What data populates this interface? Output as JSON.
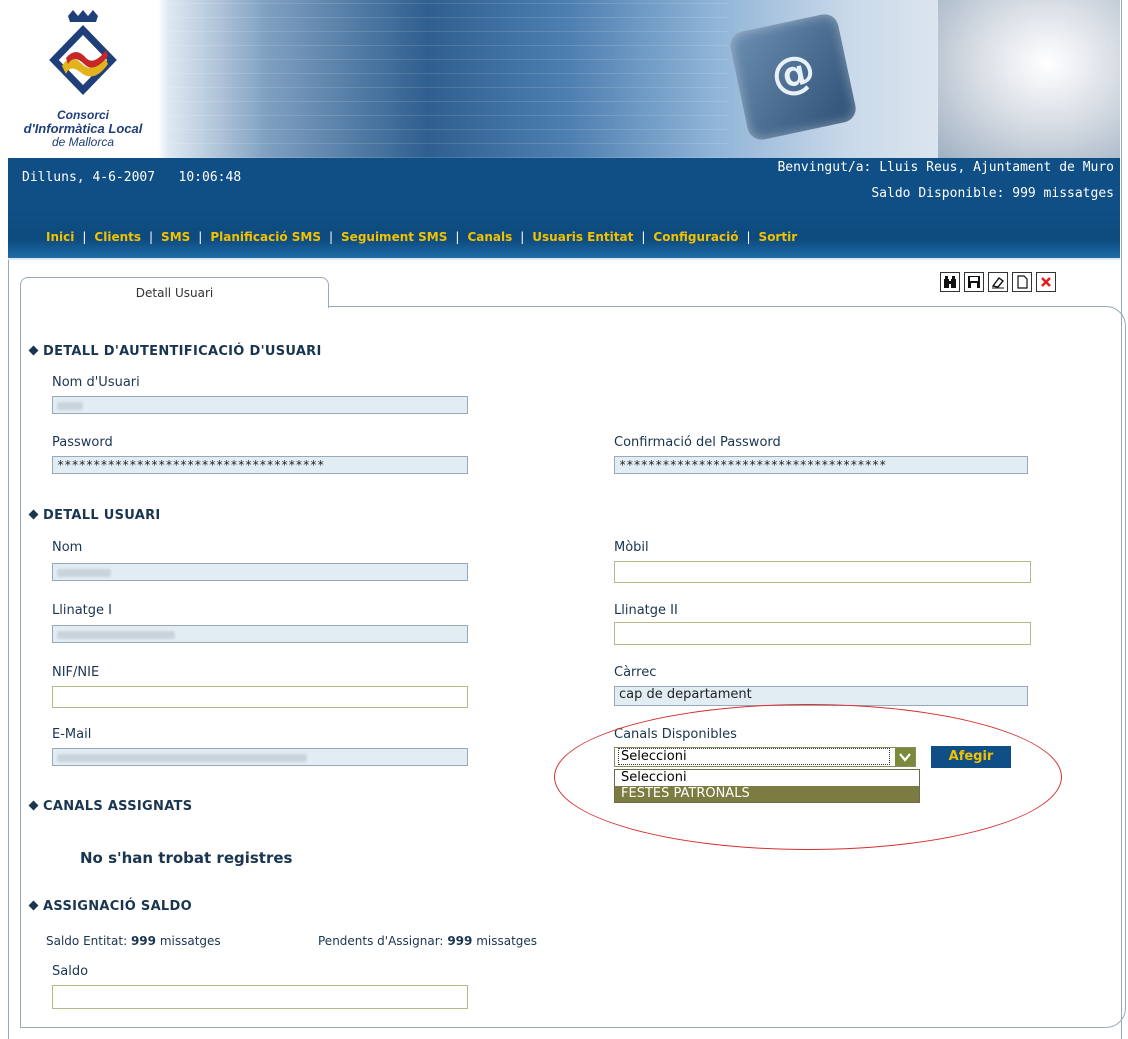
{
  "header": {
    "logo_line1": "Consorci",
    "logo_line2": "d'Informàtica Local",
    "logo_line3": "de Mallorca",
    "date_time": "Dilluns, 4-6-2007   10:06:48",
    "welcome": "Benvingut/a: Lluis Reus, Ajuntament de Muro",
    "saldo": "Saldo Disponible: 999 missatges",
    "key_symbol": "@"
  },
  "menu": {
    "items": [
      "Inici",
      "Clients",
      "SMS",
      "Planificació SMS",
      "Seguiment SMS",
      "Canals",
      "Usuaris Entitat",
      "Configuració",
      "Sortir"
    ],
    "separator": "|"
  },
  "tab": {
    "label": "Detall Usuari"
  },
  "toolbar": {
    "icons": [
      "binoculars-icon",
      "save-icon",
      "eraser-icon",
      "new-document-icon",
      "delete-icon"
    ]
  },
  "auth": {
    "title": "DETALL D'AUTENTIFICACIÓ D'USUARI",
    "username_label": "Nom d'Usuari",
    "password_label": "Password",
    "password_value": "*************************************",
    "confirm_label": "Confirmació del Password",
    "confirm_value": "*************************************"
  },
  "user": {
    "title": "DETALL USUARI",
    "nom_label": "Nom",
    "mobil_label": "Mòbil",
    "llinatge1_label": "Llinatge I",
    "llinatge2_label": "Llinatge II",
    "nif_label": "NIF/NIE",
    "carrec_label": "Càrrec",
    "carrec_value": "cap de departament",
    "email_label": "E-Mail",
    "canals_label": "Canals Disponibles",
    "canals_selected": "Seleccioni",
    "canals_options": [
      "Seleccioni",
      "FESTES PATRONALS"
    ],
    "add_button": "Afegir"
  },
  "assigned": {
    "title": "CANALS ASSIGNATS",
    "empty": "No s'han trobat registres"
  },
  "saldo_section": {
    "title": "ASSIGNACIÓ SALDO",
    "entitat_label": "Saldo Entitat:",
    "entitat_value": "999",
    "entitat_unit": "missatges",
    "pendents_label": "Pendents d'Assignar:",
    "pendents_value": "999",
    "pendents_unit": "missatges",
    "saldo_label": "Saldo"
  },
  "colors": {
    "navy": "#0f4f85",
    "menu_text": "#f2c200",
    "highlight": "#d83030",
    "option_selected": "#7b7b42"
  }
}
